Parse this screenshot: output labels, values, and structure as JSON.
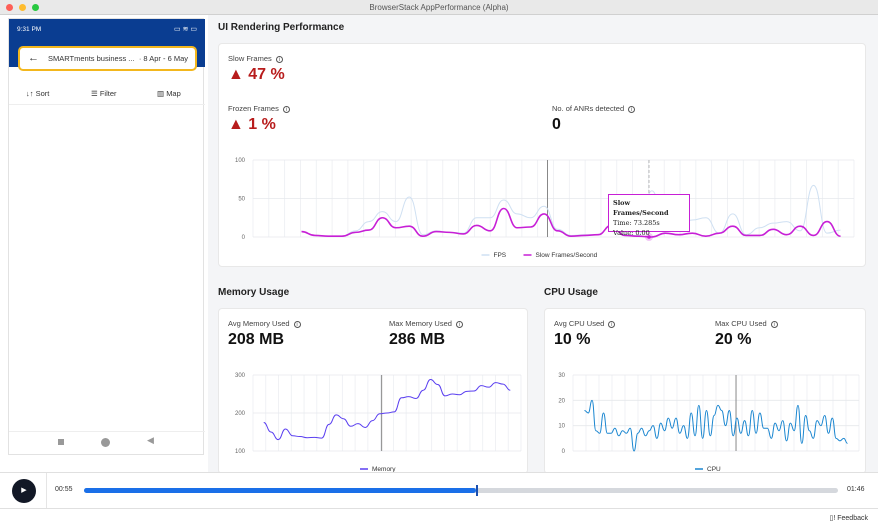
{
  "window": {
    "title": "BrowserStack AppPerformance (Alpha)"
  },
  "phone": {
    "status_time": "9:31 PM",
    "search_text": "SMARTments business ...",
    "date_range": "· 8 Apr - 6 May",
    "sort": "Sort",
    "filter": "Filter",
    "map": "Map"
  },
  "ui_rendering": {
    "title": "UI Rendering Performance",
    "slow_frames_label": "Slow Frames",
    "slow_frames_value": "47 %",
    "frozen_frames_label": "Frozen Frames",
    "frozen_frames_value": "1 %",
    "anr_label": "No. of ANRs detected",
    "anr_value": "0",
    "tooltip": {
      "title": "Slow Frames/Second",
      "time": "Time: 73.285s",
      "value": "Value: 0.00"
    }
  },
  "memory": {
    "title": "Memory Usage",
    "avg_label": "Avg Memory Used",
    "avg_value": "208 MB",
    "max_label": "Max Memory Used",
    "max_value": "286 MB"
  },
  "cpu": {
    "title": "CPU Usage",
    "avg_label": "Avg CPU Used",
    "avg_value": "10 %",
    "max_label": "Max CPU Used",
    "max_value": "20 %"
  },
  "player": {
    "current": "00:55",
    "total": "01:46",
    "progress": 0.52
  },
  "footer": {
    "feedback": "Feedback"
  },
  "colors": {
    "fps": "#4a90d9",
    "slow": "#c71fd6",
    "memory": "#5a3ff0",
    "cpu": "#1a86d0",
    "progress": "#1a6fe8"
  },
  "chart_data": [
    {
      "type": "line",
      "ylim": [
        0,
        100
      ],
      "yticks": [
        "100",
        "50",
        "0"
      ],
      "grid": true,
      "legend": "bottom",
      "x": [
        9,
        11.5,
        14,
        16.5,
        19,
        21.5,
        24,
        26.5,
        29,
        31.5,
        34,
        36.5,
        39,
        41.5,
        44,
        46.5,
        49,
        51.5,
        54,
        56.5,
        59,
        61.5,
        64,
        66.5,
        69,
        71.5,
        74,
        76.5,
        79,
        81.5,
        84,
        86.5,
        89,
        91.5,
        94,
        96.5,
        99,
        101.5,
        104,
        106.5,
        109
      ],
      "series": [
        {
          "name": "FPS",
          "values": [
            7,
            2,
            1,
            1,
            8,
            20,
            33,
            20,
            52,
            3,
            8,
            6,
            5,
            25,
            25,
            48,
            30,
            25,
            40,
            10,
            2,
            3,
            3,
            15,
            3,
            2,
            60,
            12,
            18,
            22,
            25,
            5,
            30,
            3,
            12,
            18,
            20,
            8,
            67,
            5,
            9
          ]
        },
        {
          "name": "Slow Frames/Second",
          "values": [
            7,
            2,
            1,
            1,
            6,
            9,
            25,
            12,
            14,
            1,
            7,
            6,
            4,
            15,
            8,
            37,
            12,
            13,
            30,
            8,
            1,
            2,
            3,
            15,
            2,
            1,
            0,
            5,
            3,
            5,
            1,
            5,
            14,
            2,
            2,
            10,
            3,
            14,
            2,
            20,
            1
          ]
        }
      ]
    },
    {
      "type": "line",
      "ylim": [
        100,
        300
      ],
      "yticks": [
        "300",
        "200",
        "100"
      ],
      "grid": true,
      "legend": "bottom",
      "series": [
        {
          "name": "Memory",
          "values": [
            175,
            150,
            130,
            158,
            140,
            138,
            135,
            136,
            134,
            170,
            195,
            185,
            165,
            172,
            162,
            180,
            198,
            200,
            203,
            240,
            243,
            238,
            260,
            288,
            275,
            245,
            250,
            248,
            257,
            258,
            272,
            268,
            280,
            276,
            260
          ]
        }
      ]
    },
    {
      "type": "line",
      "ylim": [
        0,
        30
      ],
      "yticks": [
        "30",
        "20",
        "10",
        "0"
      ],
      "grid": true,
      "legend": "bottom",
      "series": [
        {
          "name": "CPU",
          "values": [
            16,
            15,
            20,
            8,
            7,
            15,
            7,
            7,
            9,
            6,
            8,
            7,
            9,
            0,
            7,
            9,
            6,
            8,
            10,
            5,
            11,
            8,
            13,
            9,
            13,
            7,
            10,
            5,
            15,
            6,
            18,
            5,
            16,
            6,
            14,
            18,
            16,
            10,
            16,
            6,
            13,
            7,
            12,
            6,
            16,
            7,
            15,
            9,
            9,
            5,
            11,
            8,
            12,
            4,
            11,
            8,
            18,
            3,
            14,
            8,
            5,
            12,
            10,
            14,
            7,
            13,
            5,
            4,
            5,
            3
          ]
        }
      ]
    }
  ]
}
